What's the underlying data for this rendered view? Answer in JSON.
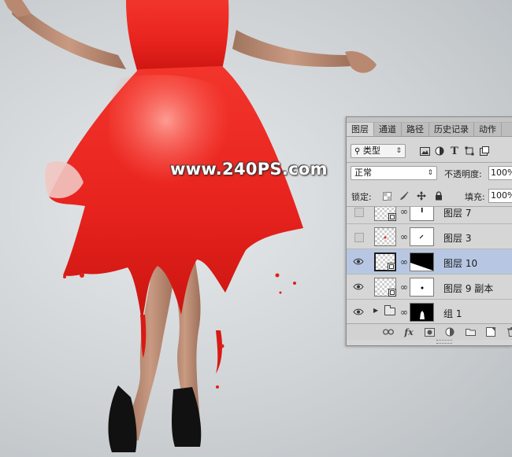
{
  "watermark": "www.240PS.com",
  "panel": {
    "tabs": [
      {
        "label": "图层",
        "active": true
      },
      {
        "label": "通道",
        "active": false
      },
      {
        "label": "路径",
        "active": false
      },
      {
        "label": "历史记录",
        "active": false
      },
      {
        "label": "动作",
        "active": false
      }
    ],
    "filter": {
      "search_icon": "search-icon",
      "kind_label": "类型",
      "icons": [
        "image-filter-icon",
        "adjustment-filter-icon",
        "type-filter-icon",
        "shape-filter-icon",
        "smart-object-filter-icon"
      ],
      "type_glyph": "T"
    },
    "blend_mode": "正常",
    "opacity_label": "不透明度:",
    "opacity_value": "100%",
    "lock_label": "锁定:",
    "fill_label": "填充:",
    "fill_value": "100%",
    "layers": [
      {
        "name": "图层 7",
        "visible": false,
        "smart_object": true,
        "mask": "white",
        "selected": false
      },
      {
        "name": "图层 3",
        "visible": false,
        "smart_object": false,
        "mask": "white",
        "selected": false
      },
      {
        "name": "图层 10",
        "visible": true,
        "smart_object": true,
        "mask": "black-diagonal",
        "selected": true
      },
      {
        "name": "图层 9 副本",
        "visible": true,
        "smart_object": true,
        "mask": "white-dot",
        "selected": false
      },
      {
        "name": "组 1",
        "visible": true,
        "group": true,
        "mask": "black-figure",
        "selected": false
      }
    ],
    "footer_icons": [
      "link-layers-icon",
      "fx-icon",
      "add-mask-icon",
      "adjustment-layer-icon",
      "new-group-icon",
      "new-layer-icon",
      "delete-icon"
    ],
    "fx_label": "fx"
  },
  "colors": {
    "dress_red": "#e8231e",
    "selection_blue": "#b7c7e3",
    "panel_gray": "#d6d6d6"
  }
}
